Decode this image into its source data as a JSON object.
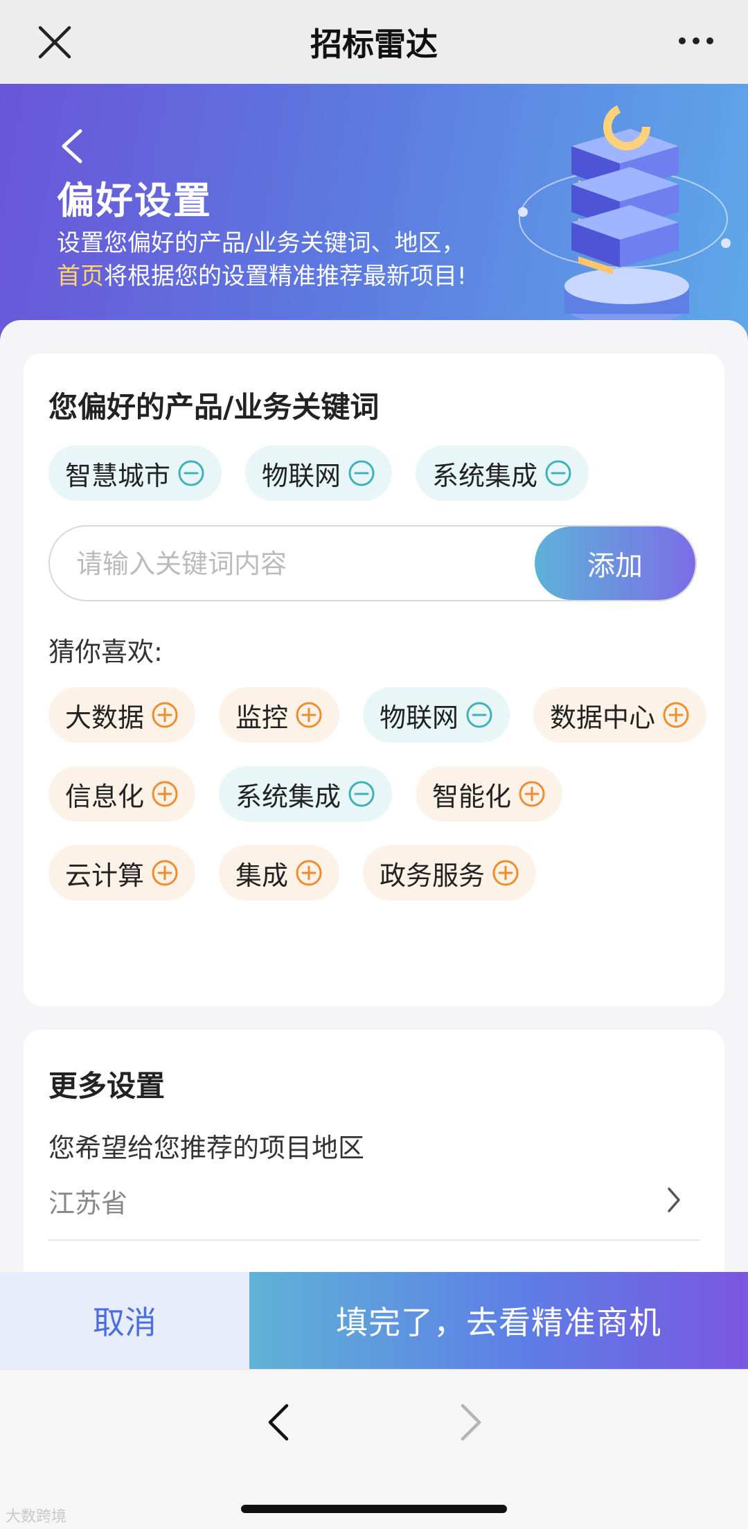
{
  "topbar": {
    "title": "招标雷达"
  },
  "banner": {
    "title": "偏好设置",
    "desc_line1": "设置您偏好的产品/业务关键词、地区，",
    "desc_highlight": "首页",
    "desc_line2_rest": "将根据您的设置精准推荐最新项目!"
  },
  "keywords": {
    "heading": "您偏好的产品/业务关键词",
    "selected": [
      "智慧城市",
      "物联网",
      "系统集成"
    ],
    "input_placeholder": "请输入关键词内容",
    "input_value": "",
    "add_label": "添加"
  },
  "suggestions": {
    "heading": "猜你喜欢:",
    "items": [
      {
        "label": "大数据",
        "selected": false
      },
      {
        "label": "监控",
        "selected": false
      },
      {
        "label": "物联网",
        "selected": true
      },
      {
        "label": "数据中心",
        "selected": false
      },
      {
        "label": "信息化",
        "selected": false
      },
      {
        "label": "系统集成",
        "selected": true
      },
      {
        "label": "智能化",
        "selected": false
      },
      {
        "label": "云计算",
        "selected": false
      },
      {
        "label": "集成",
        "selected": false
      },
      {
        "label": "政务服务",
        "selected": false
      }
    ]
  },
  "more": {
    "heading": "更多设置",
    "region_label": "您希望给您推荐的项目地区",
    "region_value": "江苏省"
  },
  "footer": {
    "cancel_label": "取消",
    "confirm_label": "填完了，去看精准商机"
  },
  "watermark": "大数跨境",
  "colors": {
    "accent_blue": "#4b6fe0",
    "selected_tag_bg": "#e8f6f7",
    "unselected_tag_bg": "#fdf2e8",
    "minus_icon": "#3cb3b9",
    "plus_icon": "#f08c2c",
    "highlight_yellow": "#ffd66b"
  }
}
